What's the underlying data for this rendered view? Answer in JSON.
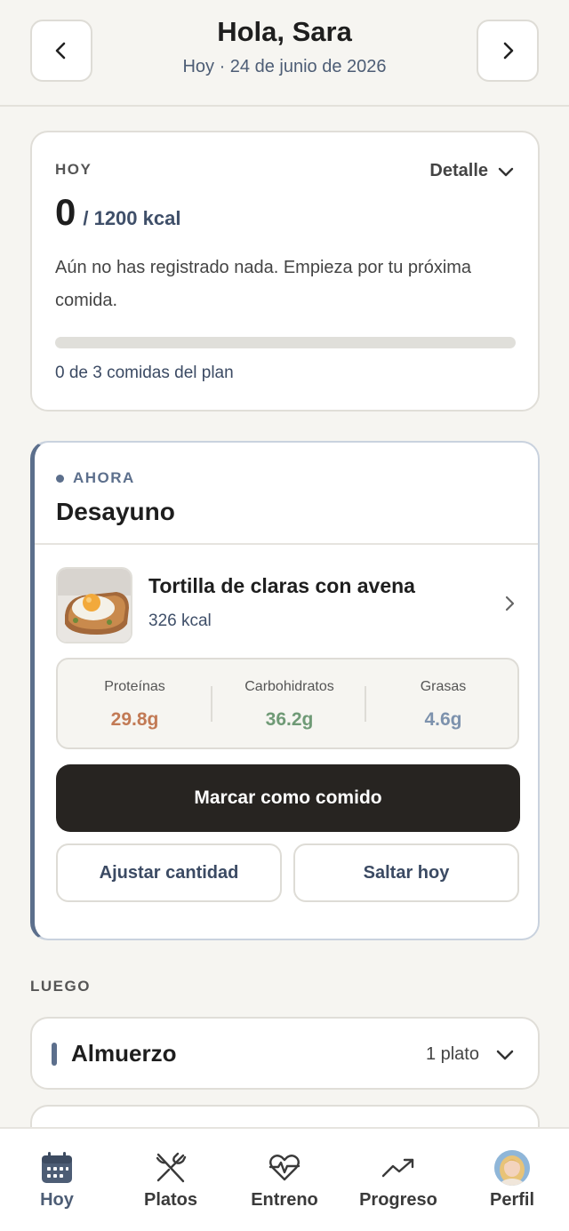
{
  "header": {
    "title": "Hola, Sara",
    "subtitle": "Hoy · 24 de junio de 2026",
    "prev_icon": "chevron-left-icon",
    "next_icon": "chevron-right-icon"
  },
  "summary": {
    "eyebrow": "HOY",
    "detail_label": "Detalle",
    "consumed_kcal": "0",
    "goal": "/ 1200 kcal",
    "message": "Aún no has registrado nada. Empieza por tu próxima comida.",
    "progress_fraction": 0,
    "meals_text": "0 de 3 comidas del plan"
  },
  "now": {
    "eyebrow": "AHORA",
    "meal_title": "Desayuno",
    "dish": {
      "name": "Tortilla de claras con avena",
      "kcal": "326 kcal"
    },
    "macros": [
      {
        "label": "Proteínas",
        "value": "29.8g",
        "color": "#c27a55"
      },
      {
        "label": "Carbohidratos",
        "value": "36.2g",
        "color": "#6f9a76"
      },
      {
        "label": "Grasas",
        "value": "4.6g",
        "color": "#7d92ad"
      }
    ],
    "primary_action": "Marcar como comido",
    "adjust_action": "Ajustar cantidad",
    "skip_action": "Saltar hoy"
  },
  "later": {
    "section_label": "LUEGO",
    "meals": [
      {
        "title": "Almuerzo",
        "count": "1 plato"
      }
    ]
  },
  "bottom_nav": [
    {
      "label": "Hoy",
      "icon": "calendar-icon",
      "active": true
    },
    {
      "label": "Platos",
      "icon": "utensils-icon",
      "active": false
    },
    {
      "label": "Entreno",
      "icon": "heart-pulse-icon",
      "active": false
    },
    {
      "label": "Progreso",
      "icon": "trending-up-icon",
      "active": false
    },
    {
      "label": "Perfil",
      "icon": "avatar",
      "active": false
    }
  ],
  "colors": {
    "accent": "#4d5d75",
    "primary_button": "#272421",
    "background": "#f6f5f1"
  }
}
